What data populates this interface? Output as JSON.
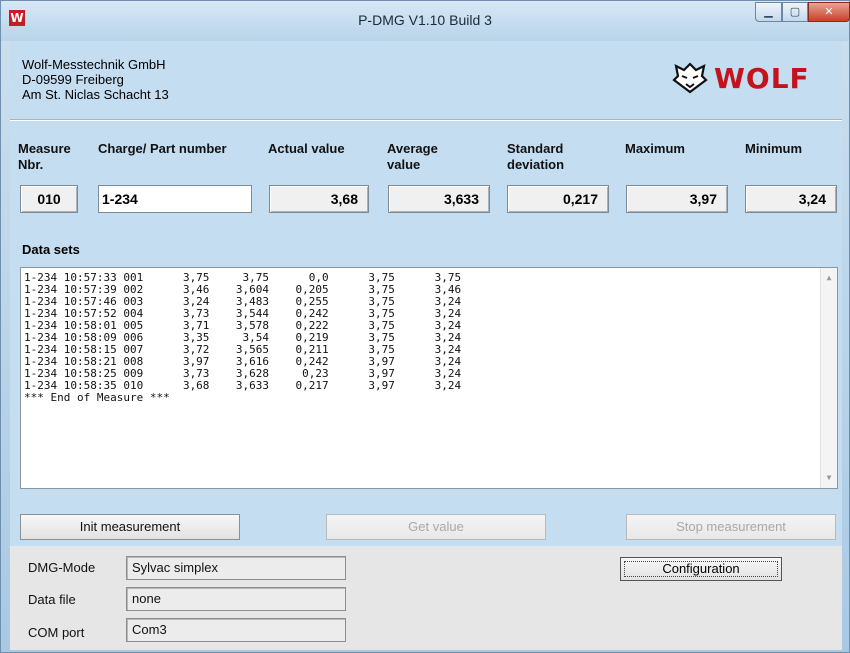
{
  "window": {
    "title": "P-DMG V1.10 Build 3",
    "app_icon": "W"
  },
  "company": {
    "name": "Wolf-Messtechnik GmbH",
    "address1": "D-09599 Freiberg",
    "address2": "Am St. Niclas Schacht 13",
    "logo_text": "WOLF",
    "logo_color": "#c3141e"
  },
  "columns": {
    "measure_nbr": "Measure\nNbr.",
    "part_number": "Charge/ Part number",
    "actual": "Actual value",
    "average": "Average\nvalue",
    "std": "Standard\ndeviation",
    "max": "Maximum",
    "min": "Minimum"
  },
  "values": {
    "measure_nbr": "010",
    "part_number": "1-234",
    "actual": "3,68",
    "average": "3,633",
    "std": "0,217",
    "max": "3,97",
    "min": "3,24"
  },
  "datasets_label": "Data sets",
  "datasets": [
    "1-234 10:57:33 001      3,75     3,75      0,0      3,75      3,75",
    "1-234 10:57:39 002      3,46    3,604    0,205      3,75      3,46",
    "1-234 10:57:46 003      3,24    3,483    0,255      3,75      3,24",
    "1-234 10:57:52 004      3,73    3,544    0,242      3,75      3,24",
    "1-234 10:58:01 005      3,71    3,578    0,222      3,75      3,24",
    "1-234 10:58:09 006      3,35     3,54    0,219      3,75      3,24",
    "1-234 10:58:15 007      3,72    3,565    0,211      3,75      3,24",
    "1-234 10:58:21 008      3,97    3,616    0,242      3,97      3,24",
    "1-234 10:58:25 009      3,73    3,628     0,23      3,97      3,24",
    "1-234 10:58:35 010      3,68    3,633    0,217      3,97      3,24",
    "*** End of Measure ***"
  ],
  "buttons": {
    "init": "Init measurement",
    "get": "Get value",
    "stop": "Stop measurement",
    "config": "Configuration"
  },
  "settings": {
    "mode_label": "DMG-Mode",
    "mode_value": "Sylvac simplex",
    "file_label": "Data file",
    "file_value": "none",
    "com_label": "COM port",
    "com_value": "Com3"
  }
}
